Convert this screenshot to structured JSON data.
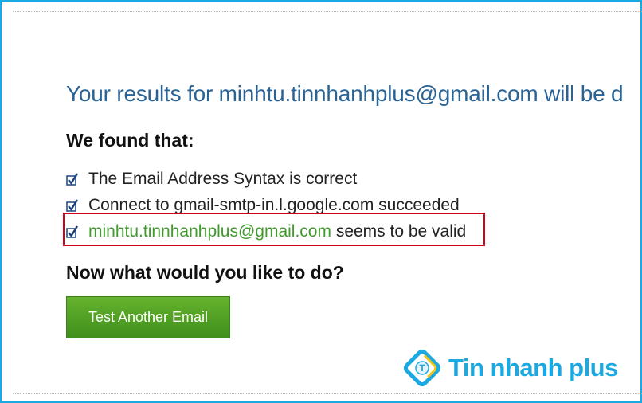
{
  "headline": "Your results for minhtu.tinnhanhplus@gmail.com will be d",
  "found_heading": "We found that:",
  "checks": [
    {
      "text": "The Email Address Syntax is correct"
    },
    {
      "text": "Connect to gmail-smtp-in.l.google.com succeeded"
    },
    {
      "email": "minhtu.tinnhanhplus@gmail.com",
      "text": " seems to be valid"
    }
  ],
  "next_heading": "Now what would you like to do?",
  "button_label": "Test Another Email",
  "watermark": {
    "text": "Tin nhanh plus",
    "icon": "tin-nhanh-plus-logo-icon"
  },
  "colors": {
    "frame_border": "#1aa9e0",
    "headline": "#2a6496",
    "valid_email": "#3f9b2a",
    "highlight": "#d0021b",
    "button": "#4fa024",
    "watermark": "#1aa9e0"
  }
}
